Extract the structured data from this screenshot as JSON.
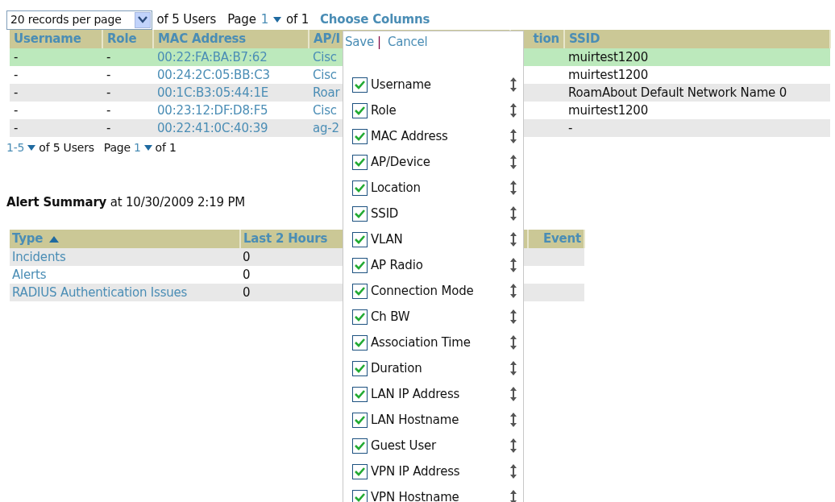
{
  "pager_top": {
    "records_per_page": "20 records per page",
    "of_users": "of 5 Users",
    "page_label": "Page",
    "page": "1",
    "of_pages": "of 1"
  },
  "choose_columns": "Choose Columns",
  "users_table": {
    "columns": [
      "Username",
      "Role",
      "MAC Address",
      "AP/I",
      "tion",
      "SSID"
    ],
    "rows": [
      {
        "selected": true,
        "username": "-",
        "role": "-",
        "mac": "00:22:FA:BA:B7:62",
        "ap": "Cisc",
        "ssid": "muirtest1200"
      },
      {
        "selected": false,
        "username": "-",
        "role": "-",
        "mac": "00:24:2C:05:BB:C3",
        "ap": "Cisc",
        "ssid": "muirtest1200"
      },
      {
        "selected": false,
        "username": "-",
        "role": "-",
        "mac": "00:1C:B3:05:44:1E",
        "ap": "Roar",
        "ssid": "RoamAbout Default Network Name 0"
      },
      {
        "selected": false,
        "username": "-",
        "role": "-",
        "mac": "00:23:12:DF:D8:F5",
        "ap": "Cisc",
        "ssid": "muirtest1200"
      },
      {
        "selected": false,
        "username": "-",
        "role": "-",
        "mac": "00:22:41:0C:40:39",
        "ap": "ag-2",
        "ssid": "-"
      }
    ]
  },
  "pager_bottom": {
    "range": "1-5",
    "of_users": "of 5 Users",
    "page_label": "Page",
    "page": "1",
    "of_pages": "of 1"
  },
  "alert_summary": {
    "title": "Alert Summary",
    "subtitle": "at 10/30/2009 2:19 PM",
    "columns": [
      {
        "label": "Type",
        "sorted": true
      },
      {
        "label": "Last 2 Hours",
        "sorted": false
      },
      {
        "label": "Event",
        "sorted": false
      }
    ],
    "rows": [
      {
        "type": "Incidents",
        "last_2_hours": "0"
      },
      {
        "type": "Alerts",
        "last_2_hours": "0"
      },
      {
        "type": "RADIUS Authentication Issues",
        "last_2_hours": "0"
      }
    ]
  },
  "column_chooser": {
    "save": "Save",
    "separator": "|",
    "cancel": "Cancel",
    "items": [
      {
        "label": "Username",
        "checked": true
      },
      {
        "label": "Role",
        "checked": true
      },
      {
        "label": "MAC Address",
        "checked": true
      },
      {
        "label": "AP/Device",
        "checked": true
      },
      {
        "label": "Location",
        "checked": true
      },
      {
        "label": "SSID",
        "checked": true
      },
      {
        "label": "VLAN",
        "checked": true
      },
      {
        "label": "AP Radio",
        "checked": true
      },
      {
        "label": "Connection Mode",
        "checked": true
      },
      {
        "label": "Ch BW",
        "checked": true
      },
      {
        "label": "Association Time",
        "checked": true
      },
      {
        "label": "Duration",
        "checked": true
      },
      {
        "label": "LAN IP Address",
        "checked": true
      },
      {
        "label": "LAN Hostname",
        "checked": true
      },
      {
        "label": "Guest User",
        "checked": true
      },
      {
        "label": "VPN IP Address",
        "checked": true
      },
      {
        "label": "VPN Hostname",
        "checked": true
      }
    ]
  }
}
